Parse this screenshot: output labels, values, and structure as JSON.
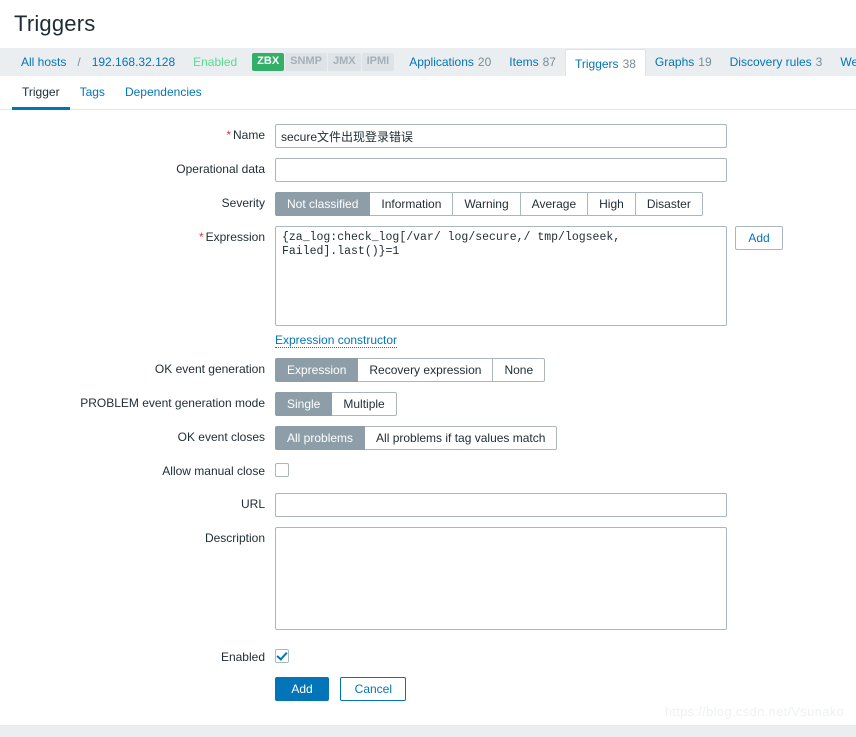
{
  "page": {
    "title": "Triggers"
  },
  "breadcrumb": {
    "all_hosts": "All hosts",
    "separator": "/",
    "host": "192.168.32.128",
    "status": "Enabled",
    "interfaces": [
      {
        "label": "ZBX",
        "active": true
      },
      {
        "label": "SNMP",
        "active": false
      },
      {
        "label": "JMX",
        "active": false
      },
      {
        "label": "IPMI",
        "active": false
      }
    ],
    "links": [
      {
        "label": "Applications",
        "count": "20",
        "active": false
      },
      {
        "label": "Items",
        "count": "87",
        "active": false
      },
      {
        "label": "Triggers",
        "count": "38",
        "active": true
      },
      {
        "label": "Graphs",
        "count": "19",
        "active": false
      },
      {
        "label": "Discovery rules",
        "count": "3",
        "active": false
      },
      {
        "label": "Web s",
        "count": "",
        "active": false
      }
    ]
  },
  "tabs": [
    {
      "label": "Trigger",
      "selected": true
    },
    {
      "label": "Tags",
      "selected": false
    },
    {
      "label": "Dependencies",
      "selected": false
    }
  ],
  "form": {
    "name": {
      "label": "Name",
      "required": "*",
      "value": "secure文件出现登录错误",
      "placeholder": ""
    },
    "operational_data": {
      "label": "Operational data",
      "value": "",
      "placeholder": ""
    },
    "severity": {
      "label": "Severity",
      "options": [
        "Not classified",
        "Information",
        "Warning",
        "Average",
        "High",
        "Disaster"
      ],
      "selected": "Not classified"
    },
    "expression": {
      "label": "Expression",
      "required": "*",
      "value": "{za_log:check_log[/var/ log/secure,/ tmp/logseek, Failed].last()}=1",
      "add_button": "Add",
      "constructor_link": "Expression constructor"
    },
    "ok_event_generation": {
      "label": "OK event generation",
      "options": [
        "Expression",
        "Recovery expression",
        "None"
      ],
      "selected": "Expression"
    },
    "problem_event_generation_mode": {
      "label": "PROBLEM event generation mode",
      "options": [
        "Single",
        "Multiple"
      ],
      "selected": "Single"
    },
    "ok_event_closes": {
      "label": "OK event closes",
      "options": [
        "All problems",
        "All problems if tag values match"
      ],
      "selected": "All problems"
    },
    "allow_manual_close": {
      "label": "Allow manual close",
      "checked": false
    },
    "url": {
      "label": "URL",
      "value": "",
      "placeholder": ""
    },
    "description": {
      "label": "Description",
      "value": "",
      "placeholder": ""
    },
    "enabled": {
      "label": "Enabled",
      "checked": true
    },
    "actions": {
      "submit": "Add",
      "cancel": "Cancel"
    }
  },
  "watermark": {
    "text": "https://blog.csdn.net/Vsunako"
  },
  "colors": {
    "accent": "#0275b8",
    "selected_segment": "#8d9ea8",
    "interface_active": "#34af67",
    "status_enabled": "#59db8f",
    "required_star": "#e33734"
  }
}
